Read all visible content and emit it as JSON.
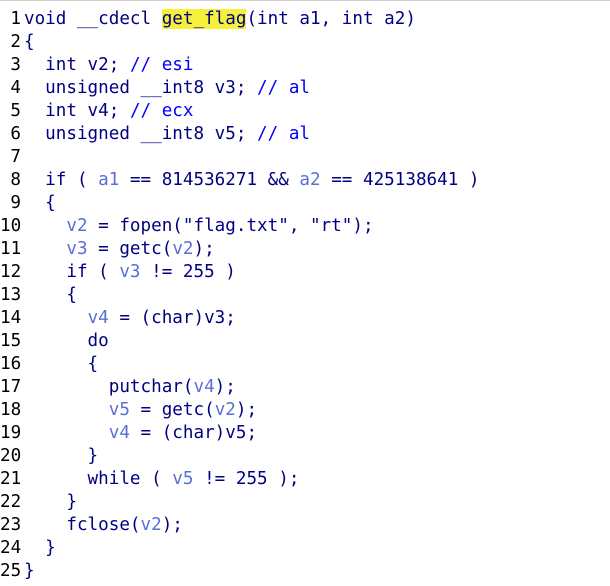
{
  "lines": [
    {
      "n": "1",
      "tokens": [
        [
          "kw",
          "void"
        ],
        [
          "p",
          " __cdecl "
        ],
        [
          "hl",
          "get_flag"
        ],
        [
          "p",
          "(int a1, int a2)"
        ]
      ]
    },
    {
      "n": "2",
      "tokens": [
        [
          "p",
          "{"
        ]
      ]
    },
    {
      "n": "3",
      "tokens": [
        [
          "p",
          "  int v2; "
        ],
        [
          "cmt",
          "// esi"
        ]
      ]
    },
    {
      "n": "4",
      "tokens": [
        [
          "p",
          "  unsigned __int8 v3; "
        ],
        [
          "cmt",
          "// al"
        ]
      ]
    },
    {
      "n": "5",
      "tokens": [
        [
          "p",
          "  int v4; "
        ],
        [
          "cmt",
          "// ecx"
        ]
      ]
    },
    {
      "n": "6",
      "tokens": [
        [
          "p",
          "  unsigned __int8 v5; "
        ],
        [
          "cmt",
          "// al"
        ]
      ]
    },
    {
      "n": "7",
      "tokens": []
    },
    {
      "n": "8",
      "tokens": [
        [
          "p",
          "  if ( "
        ],
        [
          "var",
          "a1"
        ],
        [
          "p",
          " == 814536271 && "
        ],
        [
          "var",
          "a2"
        ],
        [
          "p",
          " == 425138641 )"
        ]
      ]
    },
    {
      "n": "9",
      "tokens": [
        [
          "p",
          "  {"
        ]
      ]
    },
    {
      "n": "10",
      "tokens": [
        [
          "p",
          "    "
        ],
        [
          "var",
          "v2"
        ],
        [
          "p",
          " = fopen(\"flag.txt\", \"rt\");"
        ]
      ]
    },
    {
      "n": "11",
      "tokens": [
        [
          "p",
          "    "
        ],
        [
          "var",
          "v3"
        ],
        [
          "p",
          " = getc("
        ],
        [
          "var",
          "v2"
        ],
        [
          "p",
          ");"
        ]
      ]
    },
    {
      "n": "12",
      "tokens": [
        [
          "p",
          "    if ( "
        ],
        [
          "var",
          "v3"
        ],
        [
          "p",
          " != 255 )"
        ]
      ]
    },
    {
      "n": "13",
      "tokens": [
        [
          "p",
          "    {"
        ]
      ]
    },
    {
      "n": "14",
      "tokens": [
        [
          "p",
          "      "
        ],
        [
          "var",
          "v4"
        ],
        [
          "p",
          " = (char)v3;"
        ]
      ]
    },
    {
      "n": "15",
      "tokens": [
        [
          "p",
          "      do"
        ]
      ]
    },
    {
      "n": "16",
      "tokens": [
        [
          "p",
          "      {"
        ]
      ]
    },
    {
      "n": "17",
      "tokens": [
        [
          "p",
          "        putchar("
        ],
        [
          "var",
          "v4"
        ],
        [
          "p",
          ");"
        ]
      ]
    },
    {
      "n": "18",
      "tokens": [
        [
          "p",
          "        "
        ],
        [
          "var",
          "v5"
        ],
        [
          "p",
          " = getc("
        ],
        [
          "var",
          "v2"
        ],
        [
          "p",
          ");"
        ]
      ]
    },
    {
      "n": "19",
      "tokens": [
        [
          "p",
          "        "
        ],
        [
          "var",
          "v4"
        ],
        [
          "p",
          " = (char)v5;"
        ]
      ]
    },
    {
      "n": "20",
      "tokens": [
        [
          "p",
          "      }"
        ]
      ]
    },
    {
      "n": "21",
      "tokens": [
        [
          "p",
          "      while ( "
        ],
        [
          "var",
          "v5"
        ],
        [
          "p",
          " != 255 );"
        ]
      ]
    },
    {
      "n": "22",
      "tokens": [
        [
          "p",
          "    }"
        ]
      ]
    },
    {
      "n": "23",
      "tokens": [
        [
          "p",
          "    fclose("
        ],
        [
          "var",
          "v2"
        ],
        [
          "p",
          ");"
        ]
      ]
    },
    {
      "n": "24",
      "tokens": [
        [
          "p",
          "  }"
        ]
      ]
    },
    {
      "n": "25",
      "tokens": [
        [
          "p",
          "}"
        ]
      ]
    }
  ],
  "colors": {
    "text": "#000080",
    "variable": "#5a6fd6",
    "comment": "#0000ff",
    "highlight": "#f5f03a",
    "gutter": "#000000"
  }
}
